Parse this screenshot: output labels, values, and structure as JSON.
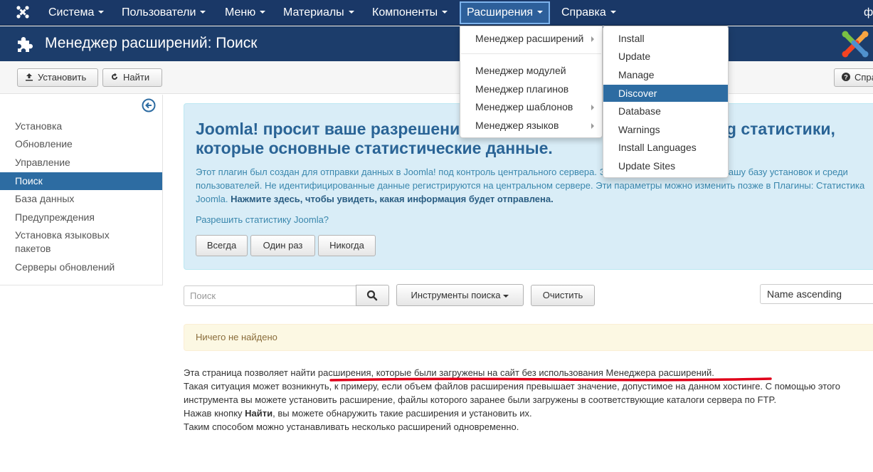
{
  "topnav": {
    "items": [
      {
        "label": "Система"
      },
      {
        "label": "Пользователи"
      },
      {
        "label": "Меню"
      },
      {
        "label": "Материалы"
      },
      {
        "label": "Компоненты"
      },
      {
        "label": "Расширения"
      },
      {
        "label": "Справка"
      }
    ],
    "user_letter": "ф"
  },
  "titlebar": {
    "title": "Менеджер расширений: Поиск"
  },
  "toolbar": {
    "install_label": "Установить",
    "discover_label": "Найти",
    "help_label": "Справка"
  },
  "sidebar": {
    "items": [
      {
        "label": "Установка"
      },
      {
        "label": "Обновление"
      },
      {
        "label": "Управление"
      },
      {
        "label": "Поиск"
      },
      {
        "label": "База данных"
      },
      {
        "label": "Предупреждения"
      },
      {
        "label": "Установка языковых пакетов"
      },
      {
        "label": "Серверы обновлений"
      }
    ]
  },
  "stats": {
    "title": "Joomla! просит ваше разрешение на сбор и отправку в Joomla.org статистики, которые основные статистические данные.",
    "desc_plain": "Этот плагин был создан для отправки данных в Joomla! под контроль центрального сервера. Эти данные отправляются в нашу базу установок и среди пользователей. Не идентифицированные данные регистрируются на центральном сервере. Эти параметры можно изменить позже в Плагины: Статистика Joomla. ",
    "desc_bold": "Нажмите здесь, чтобы увидеть, какая информация будет отправлена.",
    "question": "Разрешить статистику Joomla?",
    "always_label": "Всегда",
    "once_label": "Один раз",
    "never_label": "Никогда"
  },
  "search": {
    "placeholder": "Поиск",
    "tools_label": "Инструменты поиска",
    "clear_label": "Очистить",
    "sort_value": "Name ascending"
  },
  "notice": {
    "text": "Ничего не найдено"
  },
  "help": {
    "line1": "Эта страница позволяет найти расширения, которые были загружены на сайт без использования Менеджера расширений.",
    "line2": "Такая ситуация может возникнуть, к примеру, если объем файлов расширения превышает значение, допустимое на данном хостинге. С помощью этого",
    "line3": "инструмента вы можете установить расширение, файлы которого заранее были загружены в соответствующие каталоги сервера по FTP.",
    "line4_pre": "Нажав кнопку ",
    "line4_bold": "Найти",
    "line4_post": ", вы можете обнаружить такие расширения и установить их.",
    "line5": "Таким способом можно устанавливать несколько расширений одновременно."
  },
  "extensions_menu": {
    "items": [
      {
        "label": "Менеджер расширений"
      },
      {
        "label": "Менеджер модулей"
      },
      {
        "label": "Менеджер плагинов"
      },
      {
        "label": "Менеджер шаблонов"
      },
      {
        "label": "Менеджер языков"
      }
    ]
  },
  "manager_submenu": {
    "items": [
      {
        "label": "Install"
      },
      {
        "label": "Update"
      },
      {
        "label": "Manage"
      },
      {
        "label": "Discover"
      },
      {
        "label": "Database"
      },
      {
        "label": "Warnings"
      },
      {
        "label": "Install Languages"
      },
      {
        "label": "Update Sites"
      }
    ]
  },
  "colors": {
    "nav_bg": "#1a3867",
    "title_bg": "#1c3d6b",
    "active_blue": "#2d6ca2",
    "info_bg": "#d9edf7",
    "warning_bg": "#fcf8e3",
    "underline_red": "#e0001a"
  }
}
